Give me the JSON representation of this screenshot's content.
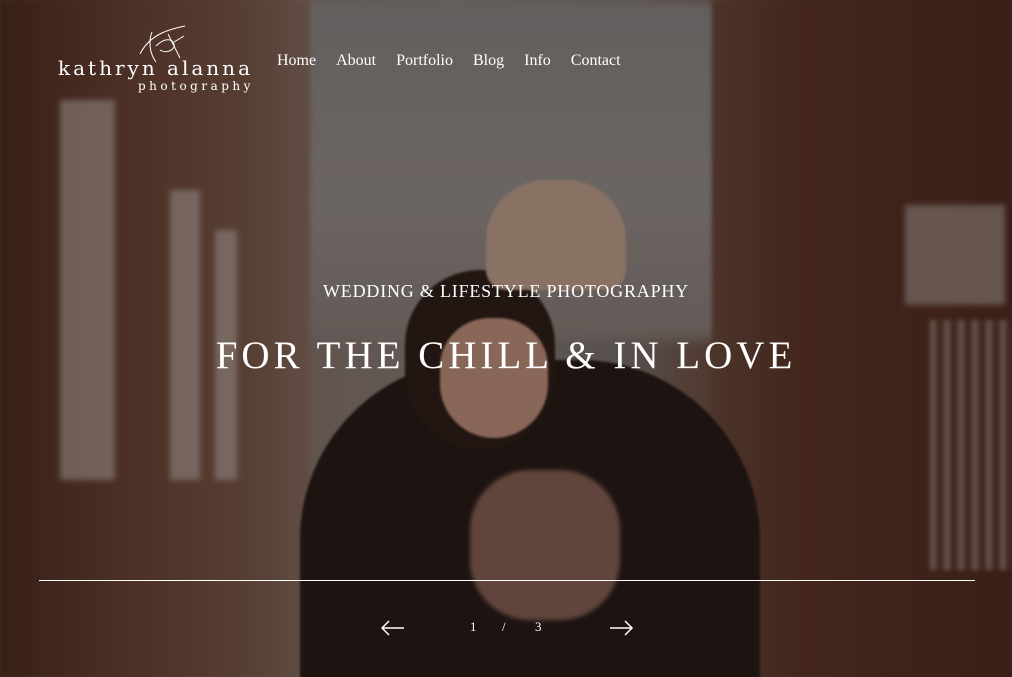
{
  "brand": {
    "name": "kathryn alanna",
    "tagline": "photography"
  },
  "nav": {
    "items": [
      {
        "label": "Home"
      },
      {
        "label": "About"
      },
      {
        "label": "Portfolio"
      },
      {
        "label": "Blog"
      },
      {
        "label": "Info"
      },
      {
        "label": "Contact"
      }
    ]
  },
  "hero": {
    "eyebrow": "WEDDING & LIFESTYLE PHOTOGRAPHY",
    "headline": "FOR THE CHILL & IN LOVE",
    "background_icon": "couple-embrace-photo"
  },
  "slider": {
    "current": "1",
    "separator": "/",
    "total": "3",
    "prev_icon": "arrow-left-icon",
    "next_icon": "arrow-right-icon"
  },
  "colors": {
    "text": "#ffffff",
    "overlay": "#140c0a"
  }
}
